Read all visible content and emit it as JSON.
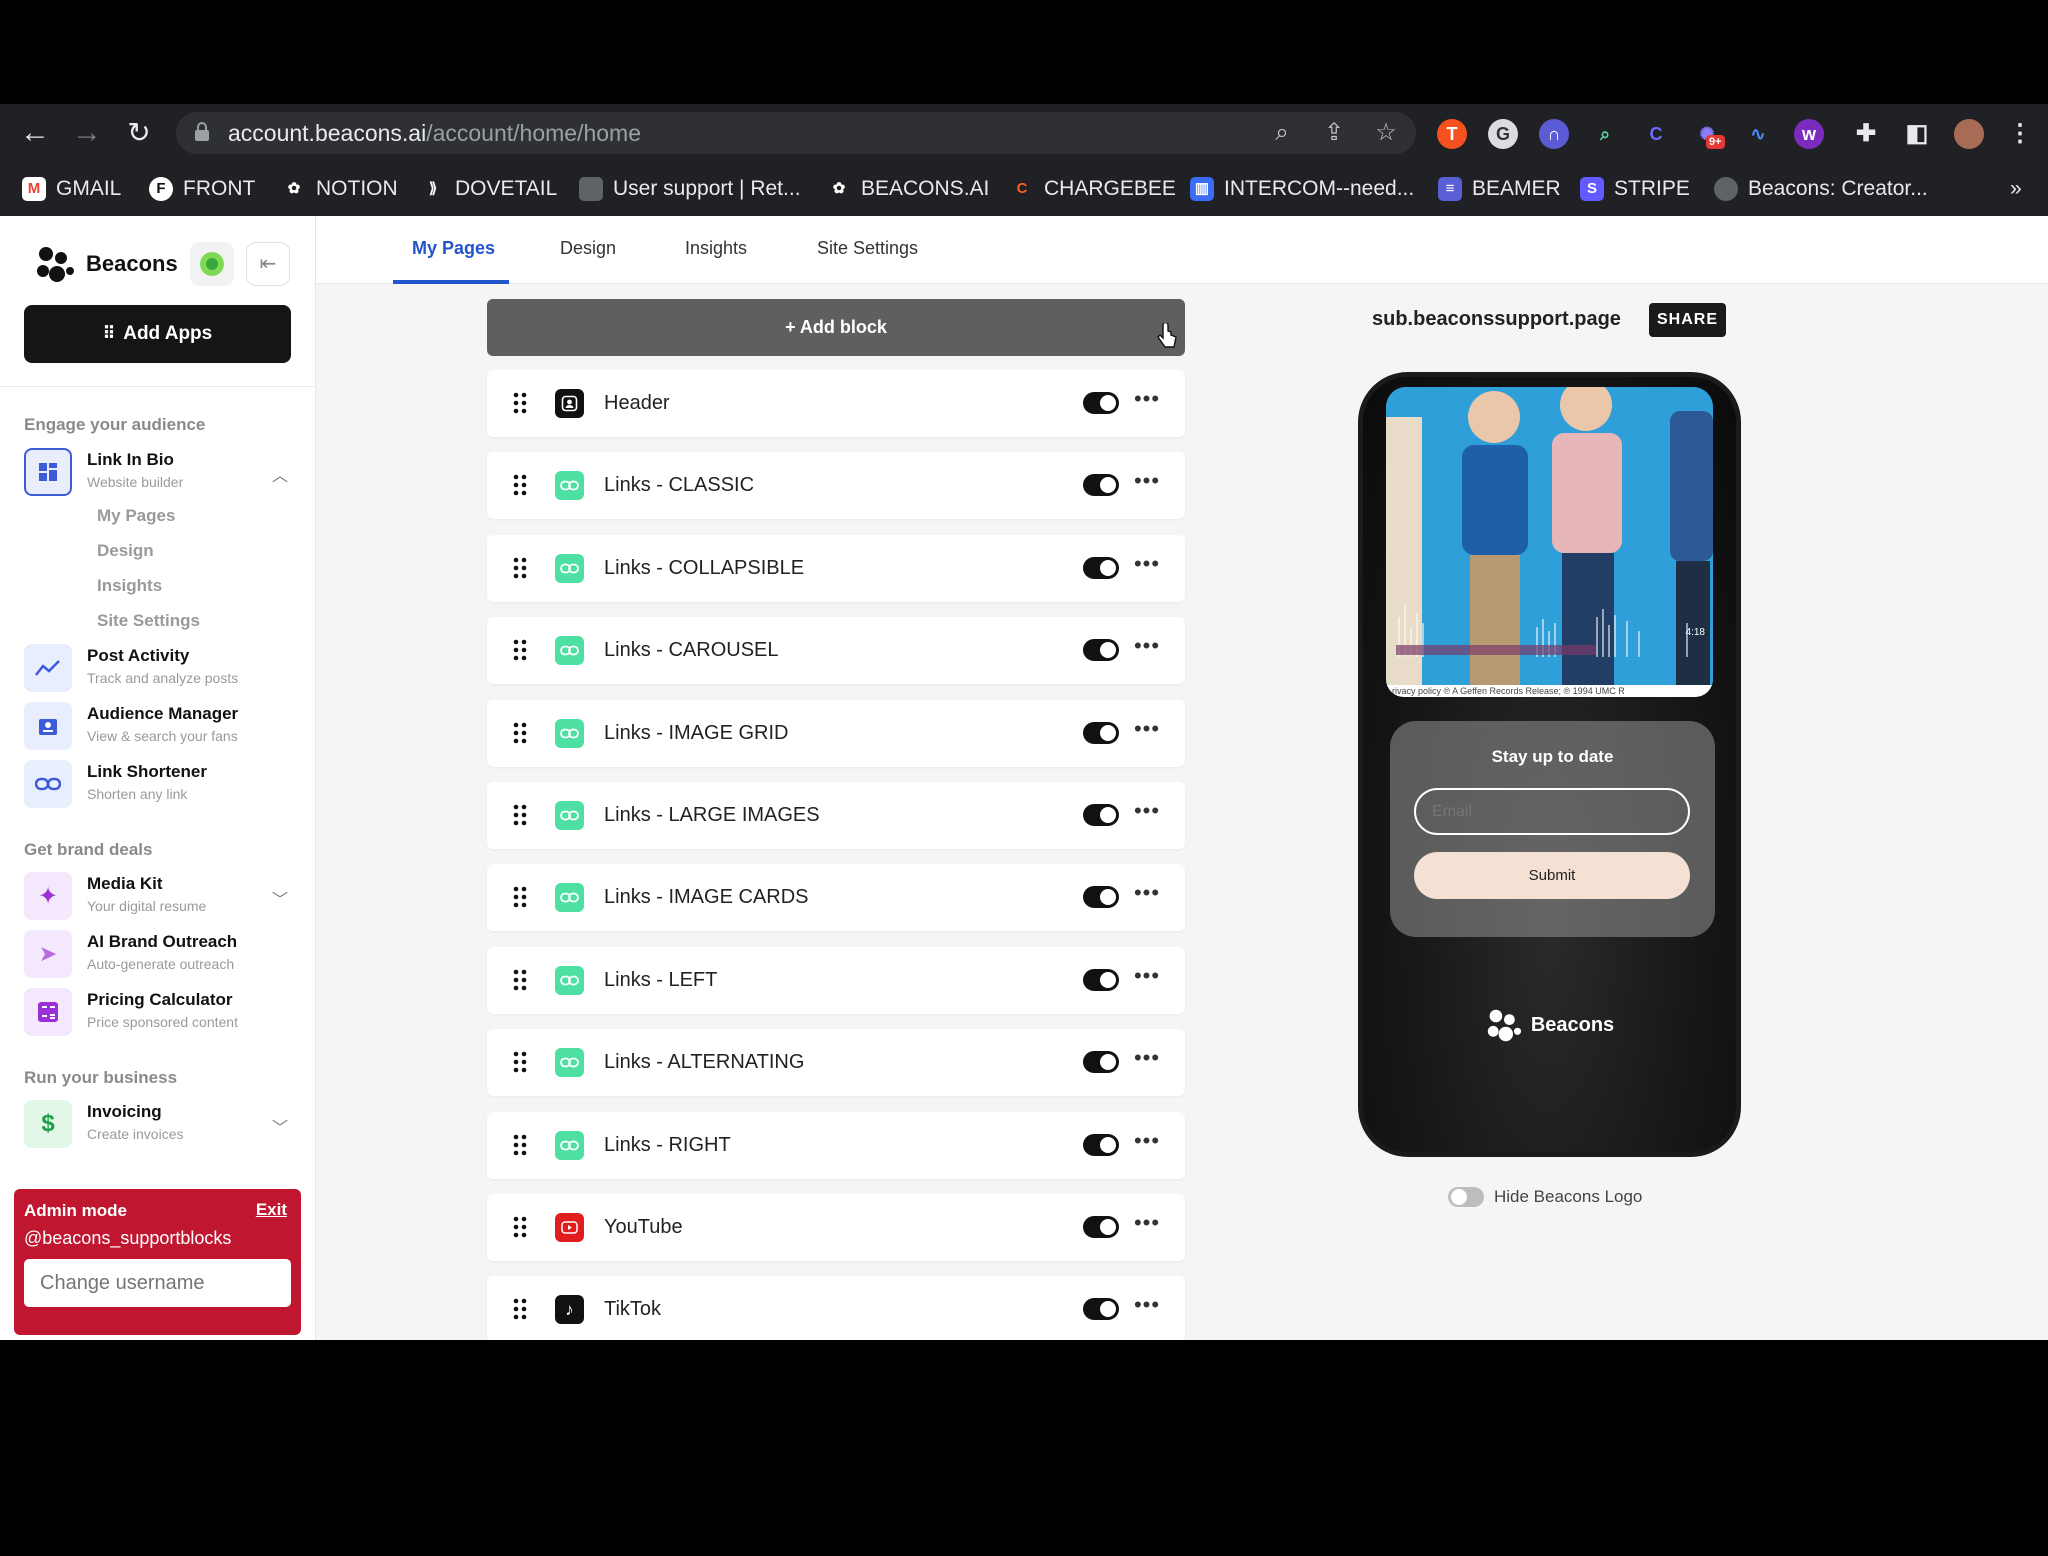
{
  "browser": {
    "url_host": "account.beacons.ai",
    "url_path": "/account/home/home",
    "bookmarks": [
      "GMAIL",
      "FRONT",
      "NOTION",
      "DOVETAIL",
      "User support | Ret...",
      "BEACONS.AI",
      "CHARGEBEE",
      "INTERCOM--need...",
      "BEAMER",
      "STRIPE",
      "Beacons: Creator..."
    ],
    "overflow": "»",
    "ext_badge": "9+"
  },
  "sidebar": {
    "brand": "Beacons",
    "add_apps": "Add Apps",
    "sections": {
      "engage": "Engage your audience",
      "brand_deals": "Get brand deals",
      "business": "Run your business"
    },
    "items": {
      "link_in_bio": {
        "title": "Link In Bio",
        "sub": "Website builder"
      },
      "post_activity": {
        "title": "Post Activity",
        "sub": "Track and analyze posts"
      },
      "audience_manager": {
        "title": "Audience Manager",
        "sub": "View & search your fans"
      },
      "link_shortener": {
        "title": "Link Shortener",
        "sub": "Shorten any link"
      },
      "media_kit": {
        "title": "Media Kit",
        "sub": "Your digital resume"
      },
      "ai_outreach": {
        "title": "AI Brand Outreach",
        "sub": "Auto-generate outreach"
      },
      "pricing_calc": {
        "title": "Pricing Calculator",
        "sub": "Price sponsored content"
      },
      "invoicing": {
        "title": "Invoicing",
        "sub": "Create invoices"
      }
    },
    "sublinks": [
      "My Pages",
      "Design",
      "Insights",
      "Site Settings"
    ],
    "admin": {
      "title": "Admin mode",
      "exit": "Exit",
      "username": "@beacons_supportblocks",
      "placeholder": "Change username"
    }
  },
  "tabs": [
    "My Pages",
    "Design",
    "Insights",
    "Site Settings"
  ],
  "editor": {
    "add_block": "+ Add block",
    "blocks": [
      {
        "label": "Header",
        "icon": "header-icon",
        "enabled": true
      },
      {
        "label": "Links - CLASSIC",
        "icon": "link-icon",
        "enabled": true
      },
      {
        "label": "Links - COLLAPSIBLE",
        "icon": "link-icon",
        "enabled": true
      },
      {
        "label": "Links - CAROUSEL",
        "icon": "link-icon",
        "enabled": true
      },
      {
        "label": "Links - IMAGE GRID",
        "icon": "link-icon",
        "enabled": true
      },
      {
        "label": "Links - LARGE IMAGES",
        "icon": "link-icon",
        "enabled": true
      },
      {
        "label": "Links - IMAGE CARDS",
        "icon": "link-icon",
        "enabled": true
      },
      {
        "label": "Links - LEFT",
        "icon": "link-icon",
        "enabled": true
      },
      {
        "label": "Links - ALTERNATING",
        "icon": "link-icon",
        "enabled": true
      },
      {
        "label": "Links - RIGHT",
        "icon": "link-icon",
        "enabled": true
      },
      {
        "label": "YouTube",
        "icon": "youtube-icon",
        "enabled": true
      },
      {
        "label": "TikTok",
        "icon": "tiktok-icon",
        "enabled": true
      }
    ]
  },
  "preview": {
    "url": "sub.beaconssupport.page",
    "share": "SHARE",
    "album_caption": "rivacy policy      ℗ A Geffen Records Release; ℗ 1994 UMC R",
    "album_time": "4:18",
    "signup_title": "Stay up to date",
    "email_placeholder": "Email",
    "submit": "Submit",
    "footer_brand": "Beacons",
    "hide_logo_label": "Hide Beacons Logo",
    "hide_logo_enabled": false
  },
  "colors": {
    "active_tab": "#2255cc",
    "link_block_icon": "#4ee0a3",
    "admin_bg": "#c0162f",
    "toggle_on": "#111111"
  }
}
